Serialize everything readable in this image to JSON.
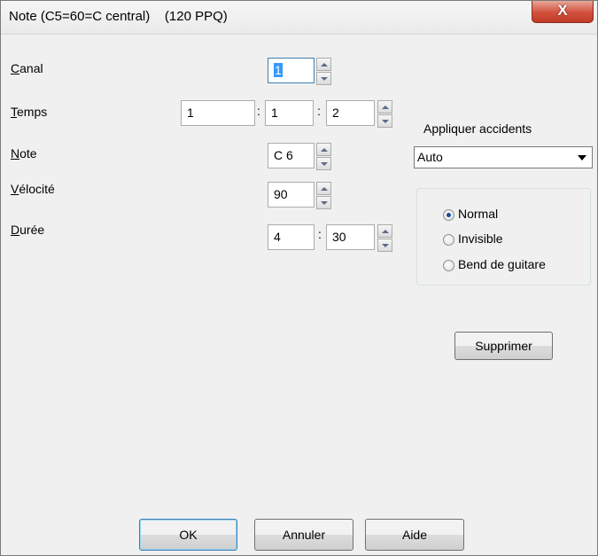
{
  "window": {
    "title": "Note (C5=60=C central)    (120 PPQ)",
    "close_label": "X"
  },
  "fields": {
    "canal": {
      "label_accel": "C",
      "label_rest": "anal",
      "value": "1"
    },
    "temps": {
      "label_accel": "T",
      "label_rest": "emps",
      "value1": "1",
      "value2": "1",
      "value3": "2",
      "sep1": ":",
      "sep2": ":"
    },
    "note": {
      "label_accel": "N",
      "label_rest": "ote",
      "value": "C 6"
    },
    "velocite": {
      "label_accel": "V",
      "label_rest": "élocité",
      "value": "90"
    },
    "duree": {
      "label_accel": "D",
      "label_rest": "urée",
      "value1": "4",
      "value2": "30",
      "sep": ":"
    }
  },
  "accidents": {
    "label": "Appliquer accidents",
    "selected": "Auto"
  },
  "note_type": {
    "options": [
      "Normal",
      "Invisible",
      "Bend de guitare"
    ],
    "selected": "Normal"
  },
  "buttons": {
    "delete": "Supprimer",
    "ok": "OK",
    "cancel": "Annuler",
    "help": "Aide"
  }
}
